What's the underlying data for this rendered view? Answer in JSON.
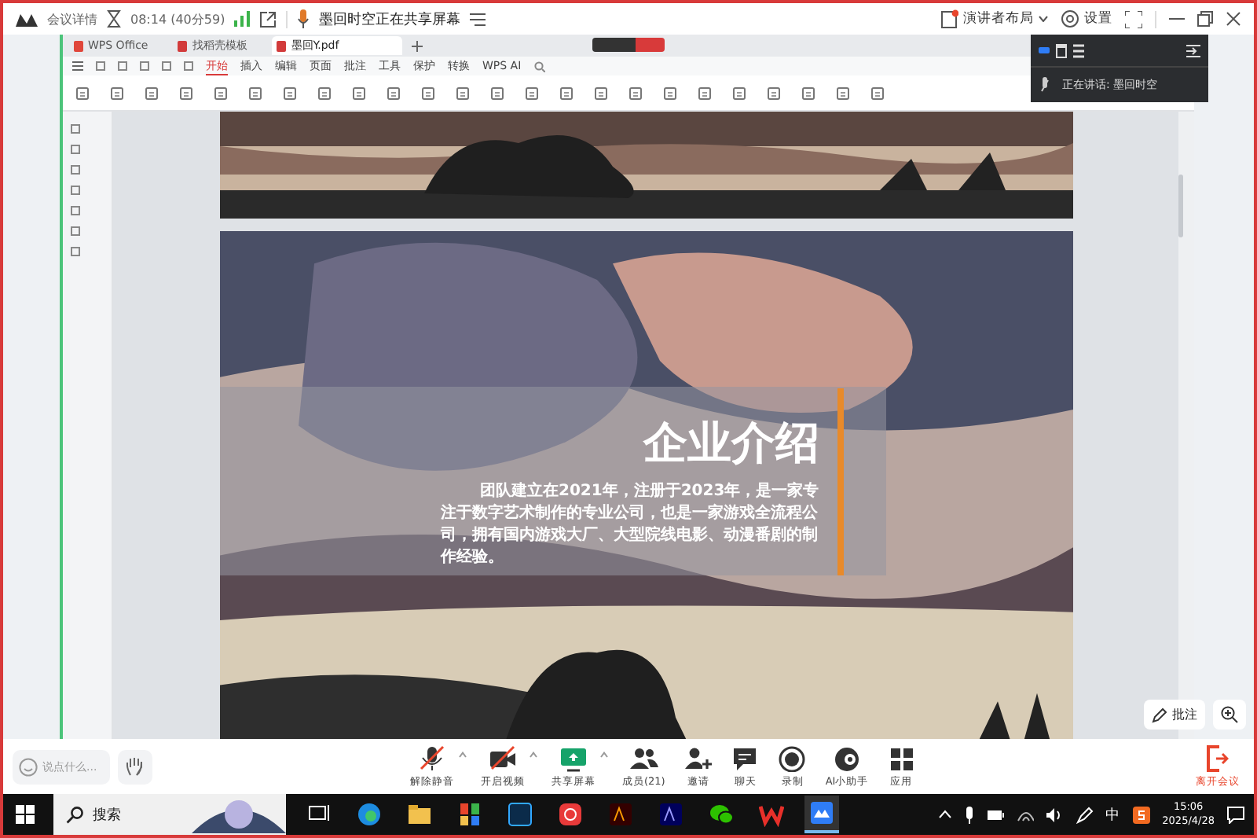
{
  "meeting_bar": {
    "title": "会议详情",
    "timer": "08:14 (40分59)",
    "sharing_notice": "墨回时空正在共享屏幕",
    "layout_button": "演讲者布局",
    "settings_button": "设置"
  },
  "shared_app": {
    "tabs": [
      {
        "label": "WPS Office",
        "selected": false
      },
      {
        "label": "找稻壳模板",
        "selected": false
      },
      {
        "label": "墨回Y.pdf",
        "selected": true
      }
    ],
    "menu": [
      {
        "label": "开始",
        "selected": true
      },
      {
        "label": "插入",
        "selected": false
      },
      {
        "label": "编辑",
        "selected": false
      },
      {
        "label": "页面",
        "selected": false
      },
      {
        "label": "批注",
        "selected": false
      },
      {
        "label": "工具",
        "selected": false
      },
      {
        "label": "保护",
        "selected": false
      },
      {
        "label": "转换",
        "selected": false
      },
      {
        "label": "WPS AI",
        "selected": false
      }
    ],
    "slide": {
      "heading": "企业介绍",
      "body": "团队建立在2021年，注册于2023年，是一家专注于数字艺术制作的专业公司，也是一家游戏全流程公司，拥有国内游戏大厂、大型院线电影、动漫番剧的制作经验。"
    }
  },
  "speaker_panel": {
    "label": "正在讲话: 墨回时空"
  },
  "chat": {
    "placeholder": "说点什么..."
  },
  "annotate_button": "批注",
  "controls": [
    {
      "kind": "mic",
      "label": "解除静音",
      "caret": true
    },
    {
      "kind": "video",
      "label": "开启视频",
      "caret": true
    },
    {
      "kind": "share",
      "label": "共享屏幕",
      "caret": true
    },
    {
      "kind": "members",
      "label": "成员(21)",
      "caret": false
    },
    {
      "kind": "invite",
      "label": "邀请",
      "caret": false
    },
    {
      "kind": "chat",
      "label": "聊天",
      "caret": false
    },
    {
      "kind": "record",
      "label": "录制",
      "caret": false
    },
    {
      "kind": "ai",
      "label": "AI小助手",
      "caret": false
    },
    {
      "kind": "apps",
      "label": "应用",
      "caret": false
    }
  ],
  "leave_button": "离开会议",
  "taskbar": {
    "search": "搜索",
    "ime": "中",
    "time": "15:06",
    "date": "2025/4/28"
  }
}
